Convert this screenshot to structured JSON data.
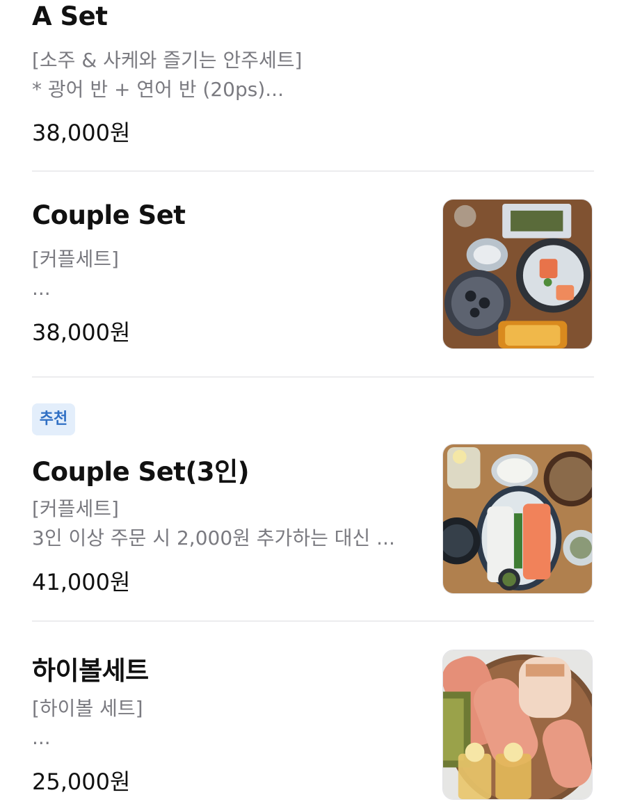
{
  "items": [
    {
      "title": "A Set",
      "desc_line1": "[소주 & 사케와 즐기는 안주세트]",
      "desc_line2": "* 광어 반 + 연어 반 (20ps)...",
      "price": "38,000원"
    },
    {
      "title": "Couple Set",
      "desc_line1": "[커플세트]",
      "desc_line2": "...",
      "price": "38,000원",
      "image": "couple-set-photo"
    },
    {
      "badge": "추천",
      "title": "Couple Set(3인)",
      "desc_line1": "[커플세트]",
      "desc_line2": "3인 이상 주문 시 2,000원 추가하는 대신 ...",
      "price": "41,000원",
      "image": "couple-set-3-photo"
    },
    {
      "title": "하이볼세트",
      "desc_line1": "[하이볼 세트]",
      "desc_line2": "...",
      "price": "25,000원",
      "image": "highball-set-photo"
    }
  ],
  "colors": {
    "badge_bg": "#e3eefb",
    "badge_text": "#2f6fc4",
    "desc_text": "#7a7a80",
    "divider": "#ececee"
  }
}
